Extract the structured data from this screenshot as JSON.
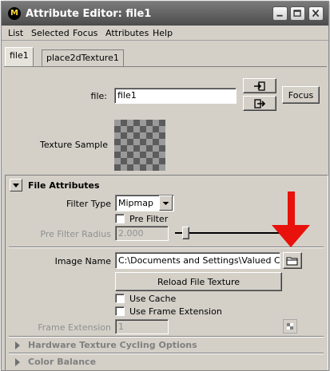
{
  "window": {
    "title": "Attribute Editor: file1"
  },
  "menu": [
    "List",
    "Selected",
    "Focus",
    "Attributes",
    "Help"
  ],
  "tabs": [
    "file1",
    "place2dTexture1"
  ],
  "file_row": {
    "label": "file:",
    "value": "file1",
    "focus_label": "Focus"
  },
  "texture_sample": {
    "label": "Texture Sample"
  },
  "file_attributes": {
    "header": "File Attributes",
    "filter_type": {
      "label": "Filter Type",
      "value": "Mipmap"
    },
    "pre_filter": {
      "label": "Pre Filter",
      "checked": false
    },
    "pre_filter_radius": {
      "label": "Pre Filter Radius",
      "value": "2.000",
      "slider_fraction": 0.0
    },
    "image_name": {
      "label": "Image Name",
      "value": "C:\\Documents and Settings\\Valued Custor"
    },
    "reload_label": "Reload File Texture",
    "use_cache": {
      "label": "Use Cache",
      "checked": false
    },
    "use_frame_extension": {
      "label": "Use Frame Extension",
      "checked": false
    },
    "frame_extension": {
      "label": "Frame Extension",
      "value": "1"
    }
  },
  "collapsed_sections": [
    "Hardware Texture Cycling Options",
    "Color Balance"
  ],
  "annotation": {
    "arrow_color": "#e8110c"
  }
}
